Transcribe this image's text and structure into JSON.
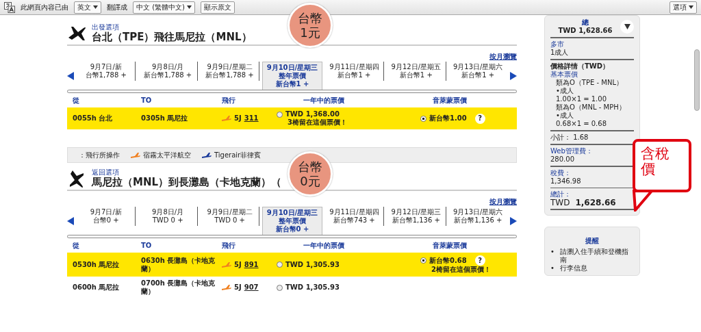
{
  "translate_bar": {
    "prefix": "此網頁內容已由",
    "source_language": "英文",
    "middle": "翻譯成",
    "target_language": "中文 (繁體中文)",
    "show_original": "顯示原文",
    "options": "選項"
  },
  "outbound": {
    "kind": "depart",
    "label": "出發選項",
    "route": "台北（TPE）飛往馬尼拉（MNL）",
    "month_link": "按月瀏覽",
    "annotation": [
      "台幣",
      "1元"
    ],
    "dates": [
      {
        "date": "9月7日/新",
        "price": "台幣1,788 +",
        "selected": false
      },
      {
        "date": "9月8日/月",
        "price": "新台幣1,788 +",
        "selected": false
      },
      {
        "date": "9月9日/星期二",
        "price": "新台幣1,788 +",
        "selected": false
      },
      {
        "date": "9月10日/星期三",
        "fare_label": "整年票價",
        "price": "新台幣1 +",
        "selected": true
      },
      {
        "date": "9月11日/星期四",
        "price": "新台幣1 +",
        "selected": false
      },
      {
        "date": "9月12日/星期五",
        "price": "新台幣1 +",
        "selected": false
      },
      {
        "date": "9月13日/星期六",
        "price": "新台幣1 +",
        "selected": false
      }
    ],
    "columns": [
      "從",
      "TO",
      "飛行",
      "一年中的票價",
      "音萊蒙票價"
    ],
    "flights": [
      {
        "highlighted": true,
        "depart_time": "0055h",
        "depart_city": "台北",
        "arrive_time": "0305h",
        "arrive_city": "馬尼拉",
        "carrier": "5J",
        "flight_number": "311",
        "fares": [
          {
            "price": "TWD 1,368.00",
            "note": "3椅留在這個票價！",
            "selected": false
          },
          {
            "price": "新台幣1.00",
            "help": "?",
            "selected": true
          }
        ]
      }
    ]
  },
  "legend": {
    "label": "：飛行所操作",
    "airlines": [
      {
        "name": "宿霧太平洋航空",
        "color": "#f08020"
      },
      {
        "name": "Tigerair菲律賓",
        "color": "#1a3a9a"
      }
    ]
  },
  "return": {
    "kind": "return",
    "label": "返回選項",
    "route": "馬尼拉（MNL）到長灘島（卡地克蘭）（",
    "month_link": "按月瀏覽",
    "annotation": [
      "台幣",
      "0元"
    ],
    "dates": [
      {
        "date": "9月7日/新",
        "price": "台幣0 +",
        "selected": false
      },
      {
        "date": "9月8日/月",
        "price": "TWD 0 +",
        "selected": false
      },
      {
        "date": "9月9日/星期二",
        "price": "TWD 0 +",
        "selected": false
      },
      {
        "date": "9月10日/星期三",
        "fare_label": "整年票價",
        "price": "新台幣0 +",
        "selected": true
      },
      {
        "date": "9月11日/星期四",
        "price": "新台幣743 +",
        "selected": false
      },
      {
        "date": "9月12日/星期三",
        "price": "新台幣1,136 +",
        "selected": false
      },
      {
        "date": "9月13日/星期六",
        "price": "新台幣1,136 +",
        "selected": false
      }
    ],
    "columns": [
      "從",
      "TO",
      "飛行",
      "一年中的票價",
      "音萊蒙票價"
    ],
    "flights": [
      {
        "highlighted": true,
        "depart_time": "0530h",
        "depart_city": "馬尼拉",
        "arrive_time": "0630h",
        "arrive_city": "長灘島（卡地克蘭）",
        "carrier": "5J",
        "flight_number": "891",
        "fares": [
          {
            "price": "TWD 1,305.93",
            "selected": false
          },
          {
            "price": "新台幣0.68",
            "help": "?",
            "note": "2椅留在這個票價！",
            "selected": true
          }
        ]
      },
      {
        "highlighted": false,
        "depart_time": "0600h",
        "depart_city": "馬尼拉",
        "arrive_time": "0700h",
        "arrive_city": "長灘島（卡地克蘭）",
        "carrier": "5J",
        "flight_number": "907",
        "fares": [
          {
            "price": "TWD 1,305.93",
            "selected": false
          }
        ]
      }
    ]
  },
  "summary": {
    "title": "總",
    "total": "TWD 1,628.66",
    "annotation": [
      "含稅",
      "價"
    ],
    "trip_type": "多市",
    "passengers": "1成人",
    "details_title": "價格詳情（TWD）",
    "base_fare_label": "基本票價",
    "base_lines": [
      "類為O（TPE - MNL）",
      "•成人",
      "1.00×1 = 1.00",
      "類為O（MNL - MPH）",
      "•成人",
      "0.68×1 = 0.68"
    ],
    "subtotal": "小計： 1.68",
    "fees": [
      {
        "label": "Web管理費：",
        "value": "280.00"
      },
      {
        "label": "稅費：",
        "value": "1,346.98"
      }
    ],
    "grand_label": "總計：",
    "grand_currency": "TWD",
    "grand_amount": "1,628.66"
  },
  "reminder": {
    "title": "提醒",
    "marker": "•",
    "items": [
      "請瀏入住手續和登機指南",
      "行李信息"
    ]
  }
}
